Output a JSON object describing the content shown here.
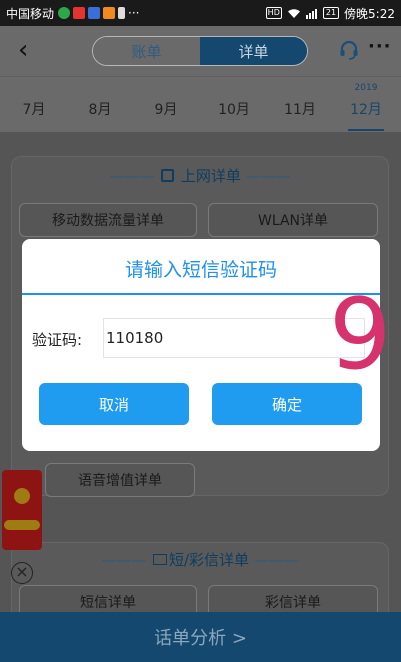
{
  "status_bar": {
    "carrier": "中国移动",
    "more": "···",
    "hd": "HD",
    "battery": "21",
    "time": "傍晚5:22",
    "notif_colors": [
      "#2aa84a",
      "#e5342f",
      "#3a6fd8",
      "#f08a1c",
      "#dddddd"
    ]
  },
  "header": {
    "back_icon": "‹",
    "tabs": [
      {
        "label": "账单",
        "selected": false
      },
      {
        "label": "详单",
        "selected": true
      }
    ],
    "more_icon": "···"
  },
  "months": {
    "year": "2019",
    "items": [
      "7月",
      "8月",
      "9月",
      "10月",
      "11月",
      "12月"
    ],
    "selected_index": 5
  },
  "sections": {
    "internet": {
      "title": "上网详单",
      "buttons": [
        "移动数据流量详单",
        "WLAN详单"
      ]
    },
    "voice_value": {
      "button": "语音增值详单"
    },
    "sms": {
      "title": "短/彩信详单",
      "buttons": [
        "短信详单",
        "彩信详单"
      ]
    }
  },
  "dialog": {
    "title": "请输入短信验证码",
    "label": "验证码:",
    "input_value": "110180",
    "cancel": "取消",
    "confirm": "确定"
  },
  "overlay_number": "9",
  "bottom_bar": {
    "label": "话单分析 >"
  },
  "colors": {
    "accent_blue": "#1f8ff0",
    "header_navy": "#14486e",
    "overlay_pink": "#d6336c"
  }
}
